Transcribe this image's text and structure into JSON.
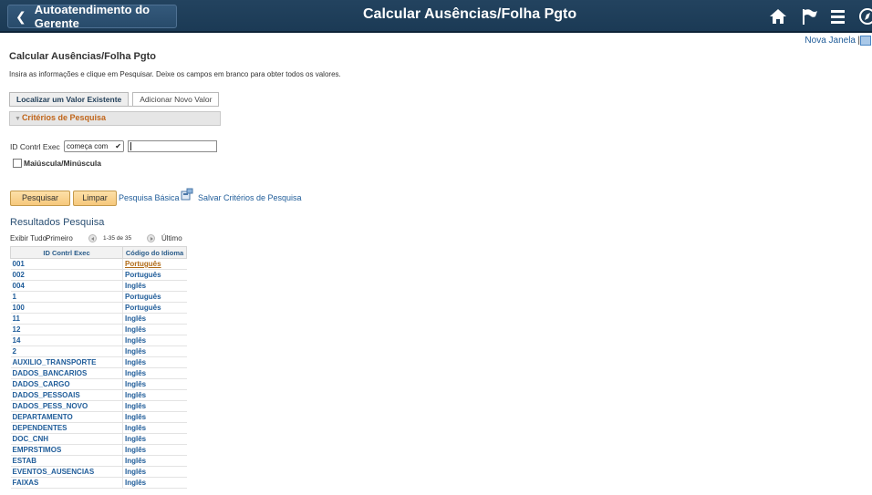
{
  "header": {
    "back_label": "Autoatendimento do Gerente",
    "page_heading": "Calcular Ausências/Folha Pgto"
  },
  "toplinks": {
    "new_window": "Nova Janela",
    "separator": "|"
  },
  "page": {
    "title": "Calcular Ausências/Folha Pgto",
    "instructions": "Insira as informações e clique em Pesquisar. Deixe os campos em branco para obter todos os valores."
  },
  "tabs": [
    "Localizar um Valor Existente",
    "Adicionar Novo Valor"
  ],
  "criteria": {
    "title": "Critérios de Pesquisa",
    "field_label": "ID Contrl Exec",
    "operator": "começa com",
    "value": "",
    "case_label": "Maiúscula/Minúscula"
  },
  "actions": {
    "search": "Pesquisar",
    "clear": "Limpar",
    "basic": "Pesquisa Básica",
    "save": "Salvar Critérios de Pesquisa"
  },
  "results": {
    "heading": "Resultados Pesquisa",
    "nav": {
      "show_all": "Exibir Tudo",
      "first": "Primeiro",
      "range": "1-35 de 35",
      "last": "Último"
    },
    "columns": [
      "ID Contrl Exec",
      "Código do Idioma"
    ],
    "rows": [
      [
        "001",
        "Português"
      ],
      [
        "002",
        "Português"
      ],
      [
        "004",
        "Inglês"
      ],
      [
        "1",
        "Português"
      ],
      [
        "100",
        "Português"
      ],
      [
        "11",
        "Inglês"
      ],
      [
        "12",
        "Inglês"
      ],
      [
        "14",
        "Inglês"
      ],
      [
        "2",
        "Inglês"
      ],
      [
        "AUXILIO_TRANSPORTE",
        "Inglês"
      ],
      [
        "DADOS_BANCARIOS",
        "Inglês"
      ],
      [
        "DADOS_CARGO",
        "Inglês"
      ],
      [
        "DADOS_PESSOAIS",
        "Inglês"
      ],
      [
        "DADOS_PESS_NOVO",
        "Inglês"
      ],
      [
        "DEPARTAMENTO",
        "Inglês"
      ],
      [
        "DEPENDENTES",
        "Inglês"
      ],
      [
        "DOC_CNH",
        "Inglês"
      ],
      [
        "EMPRSTIMOS",
        "Inglês"
      ],
      [
        "ESTAB",
        "Inglês"
      ],
      [
        "EVENTOS_AUSENCIAS",
        "Inglês"
      ],
      [
        "FAIXAS",
        "Inglês"
      ]
    ]
  },
  "icons": {
    "home": "home-icon",
    "flag": "flag-icon",
    "menu": "hamburger-menu-icon",
    "nav": "compass-icon",
    "save": "save-search-icon",
    "new_window": "new-window-icon"
  },
  "colors": {
    "banner": "#1f3e5a",
    "link": "#1f5c99",
    "button": "#f6c87c",
    "criteria_title": "#c0651a"
  }
}
